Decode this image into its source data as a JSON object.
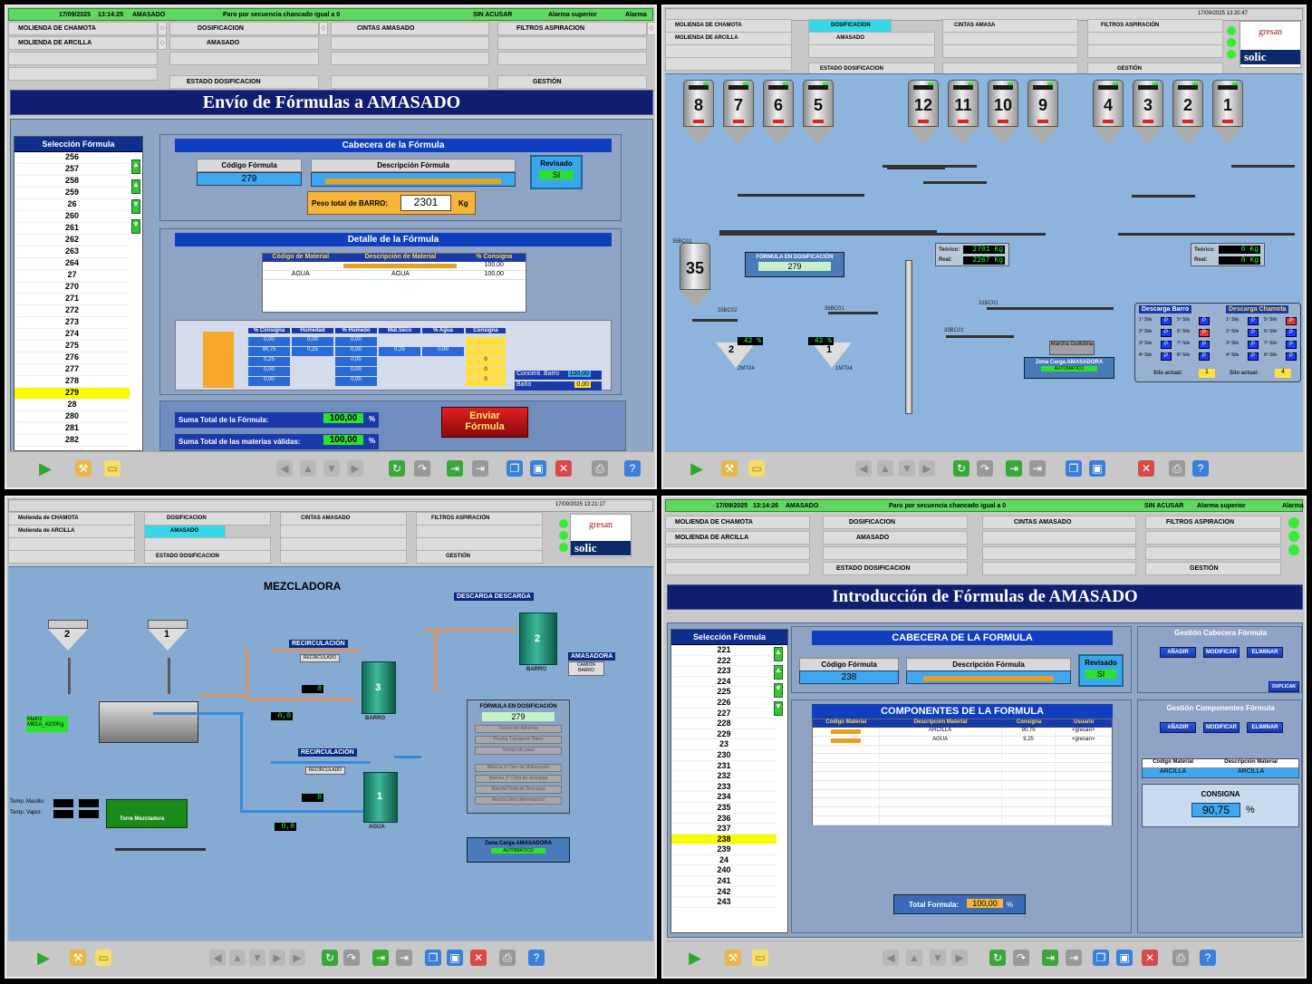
{
  "p1": {
    "status": {
      "date": "17/09/2025",
      "time": "13:14:25",
      "area": "AMASADO",
      "message": "Paro por secuencia chancado igual a 0",
      "ack": "SIN ACUSAR",
      "alarm": "Alarma superior",
      "alarm_label": "Alarma"
    },
    "menu": {
      "molienda_chamota": "MOLIENDA DE CHAMOTA",
      "molienda_arcilla": "MOLIENDA DE ARCILLA",
      "dosificacion": "DOSIFICACION",
      "amasado": "AMASADO",
      "estado_dosificacion": "ESTADO DOSIFICACION",
      "cintas_amasado": "CINTAS AMASADO",
      "filtros_aspiracion": "FILTROS ASPIRACION",
      "gestion": "GESTIÓN"
    },
    "title": "Envío de Fórmulas a AMASADO",
    "list": {
      "header": "Selección Fórmula",
      "items": [
        "256",
        "257",
        "258",
        "259",
        "26",
        "260",
        "261",
        "262",
        "263",
        "264",
        "27",
        "270",
        "271",
        "272",
        "273",
        "274",
        "275",
        "276",
        "277",
        "278",
        "279",
        "28",
        "280",
        "281",
        "282"
      ],
      "selected": "279"
    },
    "cabecera": {
      "header": "Cabecera de la Fórmula",
      "codigo_label": "Código Fórmula",
      "codigo_value": "279",
      "descripcion_label": "Descripción Fórmula",
      "revisado_label": "Revisado",
      "revisado_value": "SI",
      "peso_label": "Peso total de BARRO:",
      "peso_value": "2301",
      "peso_unit": "Kg"
    },
    "detalle": {
      "header": "Detalle de la Fórmula",
      "col1": "Código de Material",
      "col2": "Descripción de Material",
      "col3": "% Consigna",
      "row1_c3": "100,00",
      "row2_c1": "AGUA",
      "row2_c2": "AGUA",
      "row2_c3": "100,00"
    },
    "mix": {
      "headers": [
        "% Consigna",
        "Humedad",
        "% Húmedo",
        "Mat.Seco",
        "% Agua",
        "Consigna"
      ],
      "rows": [
        [
          "0,00",
          "0,00",
          "0,00",
          "",
          "",
          ""
        ],
        [
          "90,75",
          "0,25",
          "0,00",
          "0,25",
          "0,00",
          ""
        ],
        [
          "0,25",
          "",
          "0,00",
          "",
          "",
          "0"
        ],
        [
          "0,00",
          "",
          "0,00",
          "",
          "",
          "0"
        ],
        [
          "0,00",
          "",
          "0,00",
          "",
          "",
          "0"
        ]
      ],
      "concent_label": "Concent. Barro",
      "concent_value": "100,00",
      "bano_label": "Baño",
      "bano_value": "0,00"
    },
    "suma_formula_label": "Suma Total de la Fórmula:",
    "suma_formula_value": "100,00",
    "suma_materias_label": "Suma Total de las materias válidas:",
    "suma_materias_value": "100,00",
    "pct": "%",
    "enviar": "Enviar Fórmula"
  },
  "p2": {
    "status": {
      "datetime": "17/09/2025 13:20:47"
    },
    "menu": {
      "molienda_chamota": "MOLIENDA DE CHAMOTA",
      "molienda_arcilla": "MOLIENDA DE ARCILLA",
      "dosificacion": "DOSIFICACION",
      "amasado": "AMASADO",
      "estado_dosificacion": "ESTADO DOSIFICACION",
      "cintas_amasa": "CINTAS AMASA",
      "filtros_aspiracion": "FILTROS ASPIRACIÓN",
      "gestion": "GESTIÓN"
    },
    "logo1": "gresan",
    "logo2": "solic",
    "silos_left": [
      "8",
      "7",
      "6",
      "5"
    ],
    "silos_mid": [
      "12",
      "11",
      "10",
      "9"
    ],
    "silos_right": [
      "4",
      "3",
      "2",
      "1"
    ],
    "silo35": "35",
    "formula_label": "FÓRMULA EN DOSIFICACIÓN",
    "formula_value": "279",
    "teorico_label": "Teórico:",
    "teorico_value": "2701 Kg",
    "real_label": "Real:",
    "real_value": "2267 Kg",
    "teorico2_value": "0 Kg",
    "real2_value": "0 Kg",
    "marcha": "Marcha Guillotina",
    "zona_label": "Zona Carga AMASADORA",
    "zona_value": "AUTOMATICO",
    "hopper2": "2",
    "hopper1": "1",
    "hopper2_val": "42 %",
    "hopper1_val": "42 %",
    "descarga_barro": "Descarga Barro",
    "descarga_chamota": "Descarga Chamota",
    "silo_rows_barro": [
      "1º Silo",
      "2º Silo",
      "3º Silo",
      "4º Silo"
    ],
    "silo_rows_barro_b": [
      "5º Silo",
      "6º Silo",
      "7º Silo",
      "8º Silo"
    ],
    "silo_rows_chamota": [
      "1º Silo",
      "2º Silo",
      "3º Silo",
      "4º Silo"
    ],
    "silo_rows_chamota_b": [
      "5º Silo",
      "6º Silo",
      "7º Silo",
      "8º Silo"
    ],
    "silo_actual_label": "Silo actual:",
    "silo_actual_barro": "1",
    "silo_actual_chamota": "4",
    "tags": {
      "a": "35BC01",
      "b": "35MT01",
      "c": "35BC02",
      "d": "36BC01",
      "e": "36MT01",
      "f": "33BC01",
      "g": "34BC01",
      "h": "33BC01",
      "i": "31BC01",
      "j": "32BC01",
      "k": "2MT04",
      "l": "1MT04"
    }
  },
  "p3": {
    "status": {
      "datetime": "17/09/2025 13:21:17"
    },
    "menu": {
      "molienda_chamota": "Molienda de CHAMOTA",
      "molienda_arcilla": "Molienda de ARCILLA",
      "dosificacion": "DOSIFICACION",
      "amasado": "AMASADO",
      "estado_dosificacion": "ESTADO DOSIFICACION",
      "cintas_amasado": "CINTAS AMASADO",
      "filtros_aspiracion": "FILTROS ASPIRACIÓN",
      "gestion": "GESTIÓN"
    },
    "logo1": "gresan",
    "logo2": "solic",
    "title": "MEZCLADORA",
    "recirc1": "RECIRCULACIÓN",
    "recirc2": "RECIRCULACIÓN",
    "descarga": "DESCARGA DESCARGA",
    "recirculado": "RECIRCULADO",
    "recirculado2": "RECIRCULADO",
    "tank_barro": "3",
    "tank_barro_label": "BARRO",
    "tank_agua": "1",
    "tank_agua_label": "AGUA",
    "tank_top": "2",
    "tank_top_label": "BARRO",
    "amasadora": "AMASADORA",
    "camion": "CAMIÓN BARRO",
    "hopper2": "2",
    "hopper1": "1",
    "matriz": "Matriz MB1A_4200Kg",
    "formula_label": "FÓRMULA EN DOSIFICACIÓN",
    "formula_value": "279",
    "steps": [
      "Transición Alimenta",
      "Prueba Transporte Barro",
      "Tiempo de paso",
      "Marcha 1ª Tren de Molturacion",
      "Marcha 2ª Cinta de descarga",
      "Marcha Cinta de Descarga",
      "Marcha silos alimentadora"
    ],
    "temp_masillo": "Temp. Masillo:",
    "temp_vapor": "Temp. Vapor:",
    "torre": "Torre Mezcladora",
    "zona_label": "Zona Carga AMASADORA",
    "zona_value": "AUTOMÁTICO",
    "dig": {
      "a": "0",
      "b": "0",
      "c": "0,0",
      "d": "0,0"
    }
  },
  "p4": {
    "status": {
      "date": "17/09/2025",
      "time": "13:14:26",
      "area": "AMASADO",
      "message": "Paro por secuencia chancado igual a 0",
      "ack": "SIN ACUSAR",
      "alarm": "Alarma superior",
      "alarm_label": "Alarma"
    },
    "menu": {
      "molienda_chamota": "MOLIENDA DE CHAMOTA",
      "molienda_arcilla": "MOLIENDA DE ARCILLA",
      "dosificacion": "DOSIFICACION",
      "amasado": "AMASADO",
      "estado_dosificacion": "ESTADO DOSIFICACION",
      "cintas_amasado": "CINTAS AMASADO",
      "filtros_aspiracion": "FILTROS ASPIRACION",
      "gestion": "GESTIÓN"
    },
    "title": "Introducción de Fórmulas de AMASADO",
    "list": {
      "header": "Selección Fórmula",
      "items": [
        "221",
        "222",
        "223",
        "224",
        "225",
        "226",
        "227",
        "228",
        "229",
        "23",
        "230",
        "231",
        "232",
        "233",
        "234",
        "235",
        "236",
        "237",
        "238",
        "239",
        "24",
        "240",
        "241",
        "242",
        "243"
      ],
      "selected": "238"
    },
    "cabecera": {
      "header": "CABECERA DE LA FORMULA",
      "codigo_label": "Código Fórmula",
      "codigo_value": "238",
      "descripcion_label": "Descripción Fórmula",
      "revisado_label": "Revisado",
      "revisado_value": "SI"
    },
    "componentes": {
      "header": "COMPONENTES DE LA FORMULA",
      "cols": [
        "Código Material",
        "Descripción Material",
        "Consigna",
        "Usuario"
      ],
      "rows": [
        [
          "",
          "ARCILLA",
          "90,75",
          "<gresan>"
        ],
        [
          "",
          "AGUA",
          "9,25",
          "<gresan>"
        ]
      ]
    },
    "total_label": "Total Formula:",
    "total_value": "100,00",
    "pct": "%",
    "gestion_cab": "Gestión Cabecera Fórmula",
    "gestion_comp": "Gestión Componentes Fórmula",
    "btns": [
      "AÑADIR",
      "MODIFICAR",
      "ELIMINAR"
    ],
    "duplicar": "DUPLICAR",
    "cod_mat_label": "Código Material",
    "desc_mat_label": "Descripción Material",
    "cod_mat_value": "ARCILLA",
    "desc_mat_value": "ARCILLA",
    "consigna_label": "CONSIGNA",
    "consigna_value": "90,75"
  }
}
